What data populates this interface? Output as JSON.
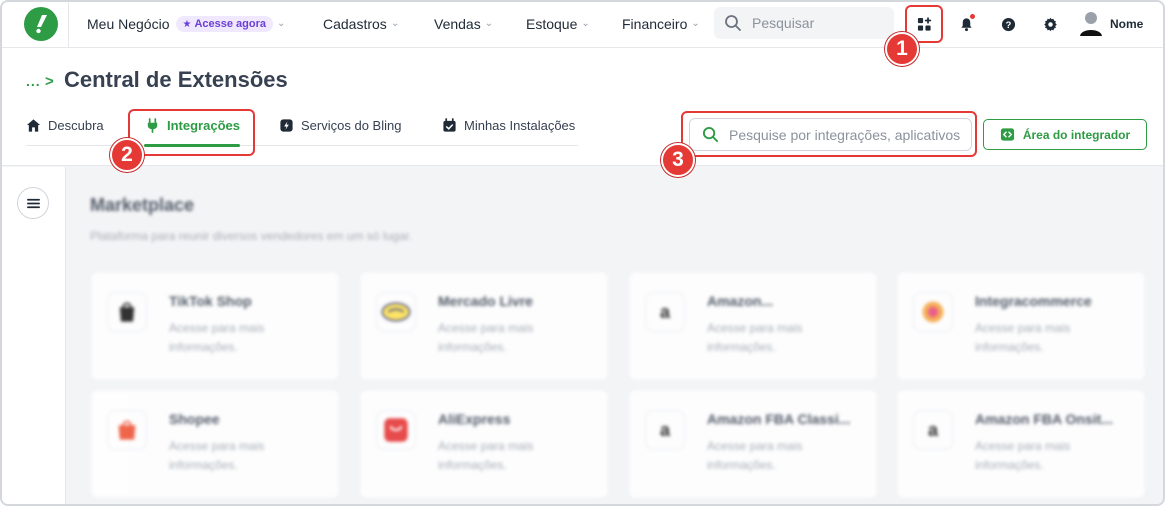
{
  "topbar": {
    "business": "Meu Negócio",
    "badge": "Acesse agora",
    "nav": [
      "Cadastros",
      "Vendas",
      "Estoque",
      "Financeiro"
    ],
    "search_placeholder": "Pesquisar",
    "user_name": "Nome",
    "icons": [
      "apps-grid-icon",
      "bell-icon",
      "help-icon",
      "gear-icon",
      "avatar-icon"
    ]
  },
  "header": {
    "breadcrumb": "...",
    "breadcrumb_separator": ">",
    "title": "Central de Extensões",
    "tabs": [
      {
        "label": "Descubra",
        "icon": "home-icon",
        "active": false
      },
      {
        "label": "Integrações",
        "icon": "plug-icon",
        "active": true
      },
      {
        "label": "Serviços do Bling",
        "icon": "bolt-icon",
        "active": false
      },
      {
        "label": "Minhas Instalações",
        "icon": "calendar-check-icon",
        "active": false
      }
    ],
    "search_placeholder": "Pesquise por integrações, aplicativos",
    "integrator_label": "Área do integrador"
  },
  "markers": [
    "1",
    "2",
    "3"
  ],
  "marketplace": {
    "title": "Marketplace",
    "subtitle": "Plataforma para reunir diversos vendedores em um só lugar.",
    "cards": [
      {
        "name": "TikTok Shop",
        "desc": "Acesse para mais informações."
      },
      {
        "name": "Mercado Livre",
        "desc": "Acesse para mais informações."
      },
      {
        "name": "Amazon...",
        "desc": "Acesse para mais informações."
      },
      {
        "name": "Integracommerce",
        "desc": "Acesse para mais informações."
      },
      {
        "name": "Shopee",
        "desc": "Acesse para mais informações."
      },
      {
        "name": "AliExpress",
        "desc": "Acesse para mais informações."
      },
      {
        "name": "Amazon FBA Classi...",
        "desc": "Acesse para mais informações."
      },
      {
        "name": "Amazon FBA Onsit...",
        "desc": "Acesse para mais informações."
      }
    ]
  },
  "colors": {
    "brand_green": "#2e9b45",
    "annotation_red": "#e53935",
    "badge_purple": "#6d3fd6"
  }
}
